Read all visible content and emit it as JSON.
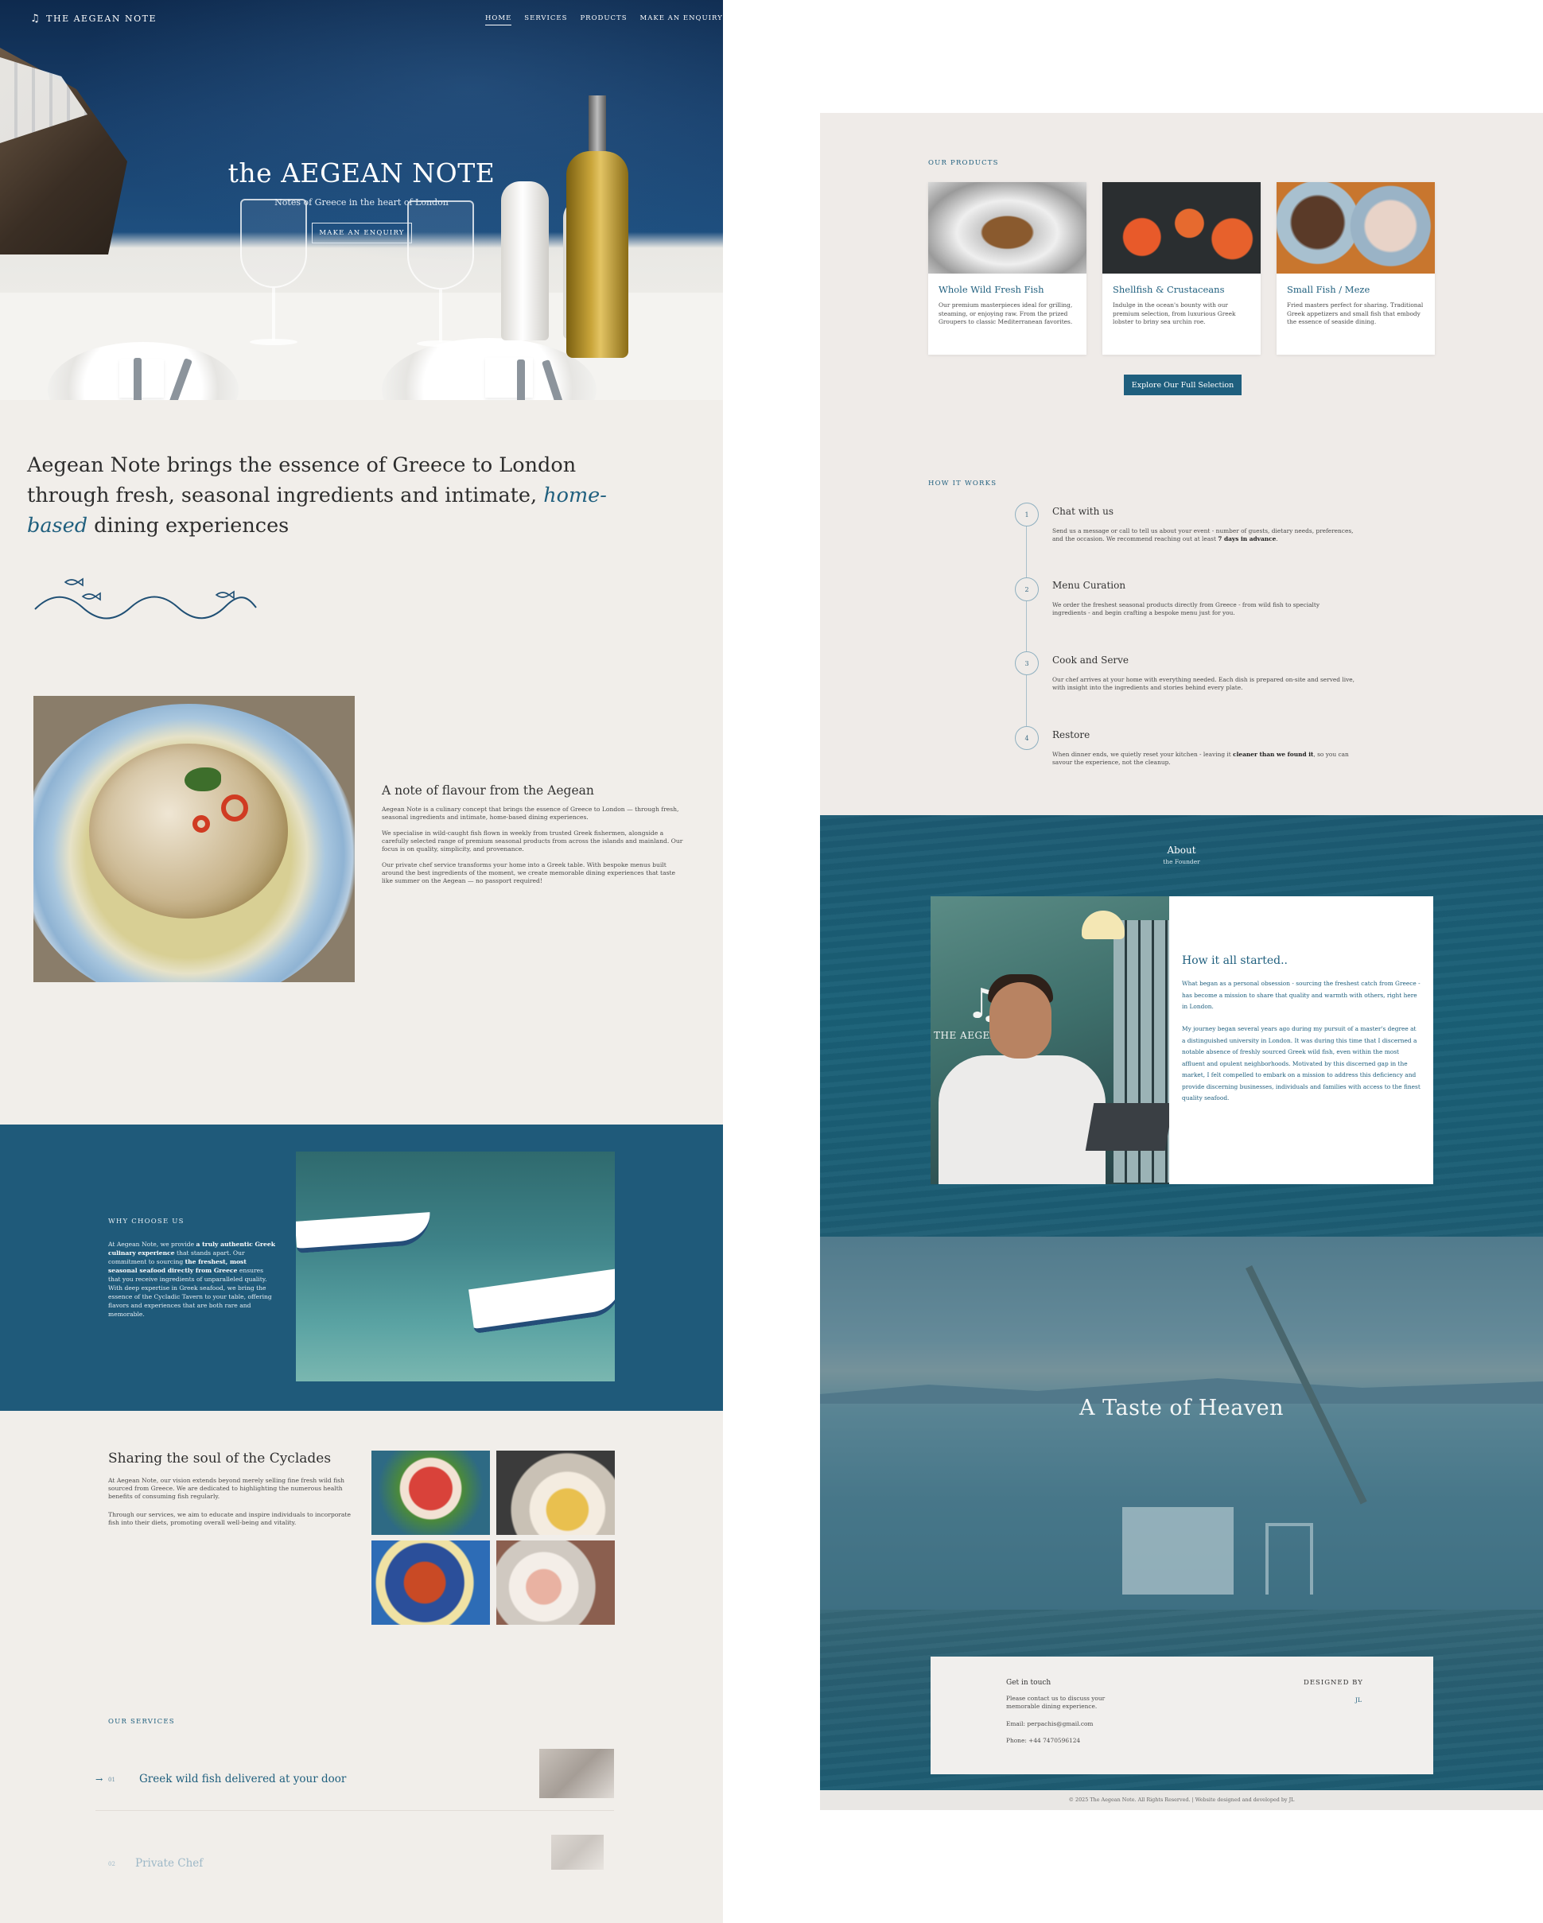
{
  "brand": {
    "name": "THE AEGEAN NOTE",
    "icon": "music-note-icon"
  },
  "nav": {
    "items": [
      "HOME",
      "SERVICES",
      "PRODUCTS",
      "MAKE AN ENQUIRY"
    ],
    "active": "HOME"
  },
  "hero": {
    "title": "the AEGEAN NOTE",
    "subtitle": "Notes of Greece in the heart of London",
    "cta": "MAKE AN ENQUIRY"
  },
  "intro": {
    "part1": "Aegean Note brings the essence of Greece to London through fresh, seasonal ingredients and intimate, ",
    "highlight": "home-based",
    "part2": " dining experiences"
  },
  "flavour": {
    "title": "A note of flavour from the Aegean",
    "p1": "Aegean Note is a culinary concept that brings the essence of Greece to London — through fresh, seasonal ingredients and intimate, home-based dining experiences.",
    "p2": "We specialise in wild-caught fish flown in weekly from trusted Greek fishermen, alongside a carefully selected range of premium seasonal products from across the islands and mainland. Our focus is on quality, simplicity, and provenance.",
    "p3": "Our private chef service transforms your home into a Greek table. With bespoke menus built around the best ingredients of the moment, we create memorable dining experiences that taste like summer on the Aegean — no passport required!"
  },
  "why": {
    "label": "WHY CHOOSE US",
    "t1": "At Aegean Note, we provide ",
    "b1": "a truly authentic Greek culinary experience",
    "t2": " that stands apart. Our commitment to sourcing ",
    "b2": "the freshest, most seasonal seafood directly from Greece",
    "t3": " ensures that you receive ingredients of unparalleled quality. With deep expertise in Greek seafood, we bring the essence of the Cycladic Tavern to your table, offering flavors and experiences that are both rare and memorable."
  },
  "cyclades": {
    "title": "Sharing the soul of the Cyclades",
    "p1": "At Aegean Note, our vision extends beyond merely selling fine fresh wild fish sourced from Greece. We are dedicated to highlighting the numerous health benefits of consuming fish regularly.",
    "p2": "Through our services, we aim to educate and inspire individuals to incorporate fish into their diets, promoting overall well-being and vitality."
  },
  "services": {
    "label": "OUR SERVICES",
    "items": [
      {
        "num": "01",
        "name": "Greek wild fish delivered at your door"
      },
      {
        "num": "02",
        "name": "Private Chef"
      }
    ]
  },
  "products": {
    "label": "OUR PRODUCTS",
    "items": [
      {
        "title": "Whole Wild Fresh Fish",
        "desc": "Our premium masterpieces ideal for grilling, steaming, or enjoying raw. From the prized Groupers to classic Mediterranean favorites."
      },
      {
        "title": "Shellfish & Crustaceans",
        "desc": "Indulge in the ocean's bounty with our premium selection, from luxurious Greek lobster to briny sea urchin roe."
      },
      {
        "title": "Small Fish / Meze",
        "desc": "Fried masters perfect for sharing. Traditional Greek appetizers and small fish that embody the essence of seaside dining."
      }
    ],
    "cta": "Explore Our Full Selection"
  },
  "how": {
    "label": "HOW IT WORKS",
    "steps": [
      {
        "num": "1",
        "title": "Chat with us",
        "desc": "Send us a message or call to tell us about your event - number of guests, dietary needs, preferences, and the occasion. We recommend reaching out at least ",
        "bold": "7 days in advance",
        "tail": "."
      },
      {
        "num": "2",
        "title": "Menu Curation",
        "desc": "We order the freshest seasonal products directly from Greece - from wild fish to specialty ingredients - and begin crafting a bespoke menu just for you.",
        "bold": "",
        "tail": ""
      },
      {
        "num": "3",
        "title": "Cook and Serve",
        "desc": "Our chef arrives at your home with everything needed. Each dish is prepared on-site and served live, with insight into the ingredients and stories behind every plate.",
        "bold": "",
        "tail": ""
      },
      {
        "num": "4",
        "title": "Restore",
        "desc": "When dinner ends, we quietly reset your kitchen - leaving it ",
        "bold": "cleaner than we found it",
        "tail": ", so you can savour the experience, not the cleanup."
      }
    ]
  },
  "about": {
    "title": "About",
    "subtitle": "the Founder",
    "photo_logo": "THE AEGEAN NOTE",
    "story_title": "How it all started..",
    "p1": "What began as a personal obsession - sourcing the freshest catch from Greece - has become a mission to share that quality and warmth with others, right here in London.",
    "p2": "My journey began several years ago during my pursuit of a master's degree at a distinguished university in London. It was during this time that I discerned a notable absence of freshly sourced Greek wild fish, even within the most affluent and opulent neighborhoods. Motivated by this discerned gap in the market, I felt compelled to embark on a mission to address this deficiency and provide discerning businesses, individuals and families with access to the finest quality seafood."
  },
  "taste": {
    "title": "A Taste of Heaven"
  },
  "contact": {
    "title": "Get in touch",
    "p": "Please contact us to discuss your memorable dining experience.",
    "email": "Email: perpachis@gmail.com",
    "phone": "Phone: +44 7470596124",
    "designed_by": "DESIGNED BY",
    "designer": "JL"
  },
  "footer": {
    "copyright": "© 2025 The Aegean Note. All Rights Reserved. | Website designed and developed by JL"
  },
  "colors": {
    "accent": "#1f5f7e",
    "band": "#1f5a7a",
    "bg": "#f1eeea"
  }
}
